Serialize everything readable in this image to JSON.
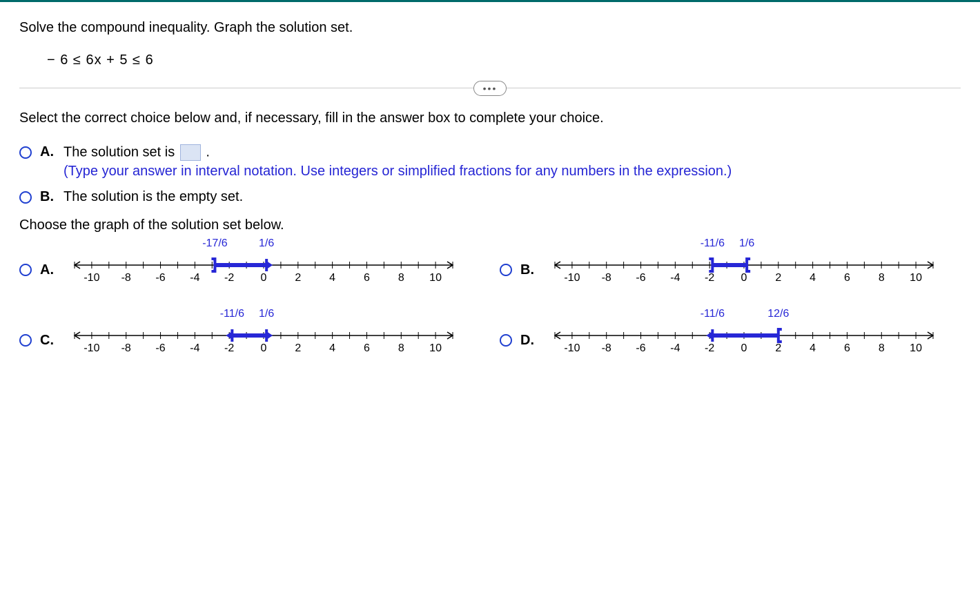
{
  "prompt": "Solve the compound inequality. Graph the solution set.",
  "inequality": "− 6 ≤ 6x + 5 ≤ 6",
  "expand_pill": "•••",
  "instruction": "Select the correct choice below and, if necessary, fill in the answer box to complete your choice.",
  "choice_A": {
    "label": "A.",
    "text_before": "The solution set is ",
    "text_after": ".",
    "hint": "(Type your answer in interval notation. Use integers or simplified fractions for any numbers in the expression.)"
  },
  "choice_B": {
    "label": "B.",
    "text": "The solution is the empty set."
  },
  "graph_instruction": "Choose the graph of the solution set below.",
  "axis_ticks": [
    "-10",
    "-8",
    "-6",
    "-4",
    "-2",
    "0",
    "2",
    "4",
    "6",
    "8",
    "10"
  ],
  "graphs": {
    "A": {
      "label": "A.",
      "left_val": "-17/6",
      "right_val": "1/6",
      "left_closed": true,
      "right_closed": false,
      "left_x": -2.833,
      "right_x": 0.167
    },
    "B": {
      "label": "B.",
      "left_val": "-11/6",
      "right_val": "1/6",
      "left_closed": true,
      "right_closed": true,
      "left_x": -1.833,
      "right_x": 0.167
    },
    "C": {
      "label": "C.",
      "left_val": "-11/6",
      "right_val": "1/6",
      "left_closed": false,
      "right_closed": false,
      "left_x": -1.833,
      "right_x": 0.167
    },
    "D": {
      "label": "D.",
      "left_val": "-11/6",
      "right_val": "12/6",
      "left_closed": false,
      "right_closed": true,
      "left_x": -1.833,
      "right_x": 2.0
    }
  }
}
